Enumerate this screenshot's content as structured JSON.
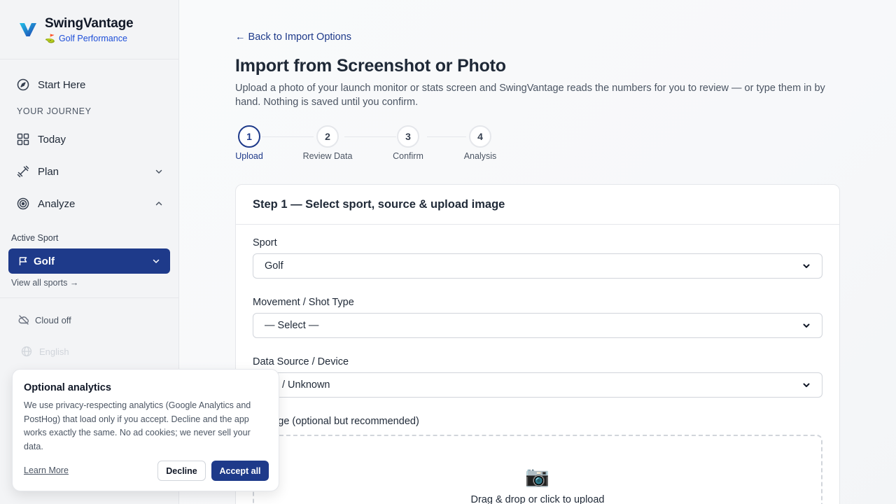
{
  "brand": {
    "name": "SwingVantage",
    "subtitle": "Golf Performance",
    "subtitle_icon": "⛳"
  },
  "sidebar": {
    "nav_top": {
      "label": "Start Here",
      "icon": "compass-icon"
    },
    "section_label": "YOUR JOURNEY",
    "items": [
      {
        "label": "Today",
        "icon": "grid-icon"
      },
      {
        "label": "Plan",
        "icon": "dumbbell-icon",
        "expanded": false
      },
      {
        "label": "Analyze",
        "icon": "target-icon",
        "expanded": true
      }
    ],
    "active_sport_label": "Active Sport",
    "active_sport": "Golf",
    "view_all": "View all sports →",
    "cloud_status": "Cloud off",
    "language": "English"
  },
  "main": {
    "back_link": "← Back to Import Options",
    "title": "Import from Screenshot or Photo",
    "description": "Upload a photo of your launch monitor or stats screen and SwingVantage reads the numbers for you to review — or type them in by hand. Nothing is saved until you confirm.",
    "steps": [
      {
        "number": "1",
        "label": "Upload",
        "active": true
      },
      {
        "number": "2",
        "label": "Review Data",
        "active": false
      },
      {
        "number": "3",
        "label": "Confirm",
        "active": false
      },
      {
        "number": "4",
        "label": "Analysis",
        "active": false
      }
    ],
    "card": {
      "title": "Step 1 — Select sport, source & upload image",
      "sport_label": "Sport",
      "sport_value": "Golf",
      "movement_label": "Movement / Shot Type",
      "movement_value": "— Select —",
      "source_label": "Data Source / Device",
      "source_value": "ner / Unknown",
      "upload_label": "d Image (optional but recommended)",
      "upload_icon": "📷",
      "upload_text": "Drag & drop or click to upload"
    }
  },
  "cookie": {
    "title": "Optional analytics",
    "text": "We use privacy-respecting analytics (Google Analytics and PostHog) that load only if you accept. Decline and the app works exactly the same. No ad cookies; we never sell your data.",
    "learn_more": "Learn More",
    "decline": "Decline",
    "accept": "Accept all"
  },
  "colors": {
    "accent": "#1e3a8a",
    "brand_link": "#1d4ed8",
    "logo_start": "#22c1e8",
    "logo_end": "#1e40af"
  }
}
